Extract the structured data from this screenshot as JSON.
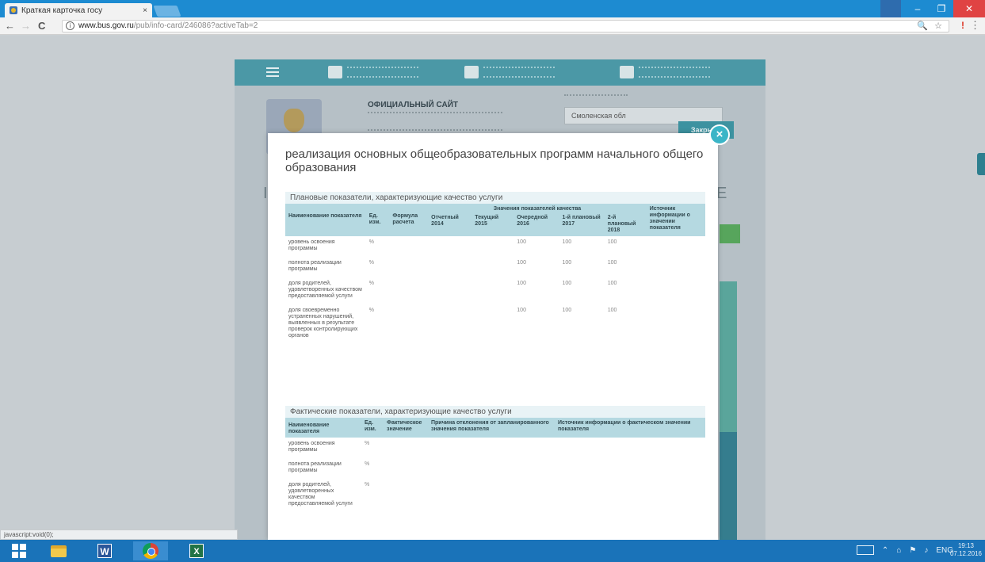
{
  "browser": {
    "tab_title": "Краткая карточка госу",
    "tab_close": "×",
    "back": "←",
    "forward": "→",
    "reload": "C",
    "url_host": "www.bus.gov.ru",
    "url_path": "/pub/info-card/246086?activeTab=2",
    "zoom_icon": "🔍",
    "star_icon": "☆",
    "ext_icon": "!",
    "menu_icon": "⋮",
    "win_min": "–",
    "win_max": "❐",
    "win_close": "✕"
  },
  "site": {
    "name": "ОФИЦИАЛЬНЫЙ САЙТ",
    "region": "Смоленская обл",
    "close_label": "Закрыть",
    "right_letter": "Е",
    "left_letter": "I"
  },
  "modal": {
    "close_icon": "×",
    "title": "реализация основных общеобразовательных программ начального общего образования",
    "planned": {
      "heading": "Плановые показатели, характеризующие качество услуги",
      "col_name": "Наименование показателя",
      "col_unit": "Ед. изм.",
      "col_formula": "Формула расчета",
      "col_group": "Значения показателей качества",
      "col_report": "Отчетный 2014",
      "col_current": "Текущий 2015",
      "col_next": "Очередной 2016",
      "col_plan1": "1-й плановый 2017",
      "col_plan2": "2-й плановый 2018",
      "col_source": "Источник информации о значении показателя",
      "rows": [
        {
          "name": "уровень освоения программы",
          "unit": "%",
          "next": "100",
          "plan1": "100",
          "plan2": "100"
        },
        {
          "name": "полнота реализации программы",
          "unit": "%",
          "next": "100",
          "plan1": "100",
          "plan2": "100"
        },
        {
          "name": "доля родителей, удовлетворенных качеством предоставляемой услуги",
          "unit": "%",
          "next": "100",
          "plan1": "100",
          "plan2": "100"
        },
        {
          "name": "доля своевременно устраненных нарушений, выявленных в результате проверок контролирующих органов",
          "unit": "%",
          "next": "100",
          "plan1": "100",
          "plan2": "100"
        }
      ]
    },
    "actual": {
      "heading": "Фактические показатели, характеризующие качество услуги",
      "col_name": "Наименование показателя",
      "col_unit": "Ед. изм.",
      "col_fact": "Фактическое значение",
      "col_reason": "Причина отклонения от запланированного значения показателя",
      "col_source": "Источник информации о фактическом значении показателя",
      "rows": [
        {
          "name": "уровень освоения программы",
          "unit": "%"
        },
        {
          "name": "полнота реализации программы",
          "unit": "%"
        },
        {
          "name": "доля родителей, удовлетворенных качеством предоставляемой услуги",
          "unit": "%"
        }
      ]
    }
  },
  "status_bar": "javascript:void(0);",
  "taskbar": {
    "word_letter": "W",
    "excel_letter": "X",
    "lang": "ENG",
    "time": "19:13",
    "date": "07.12.2016"
  }
}
